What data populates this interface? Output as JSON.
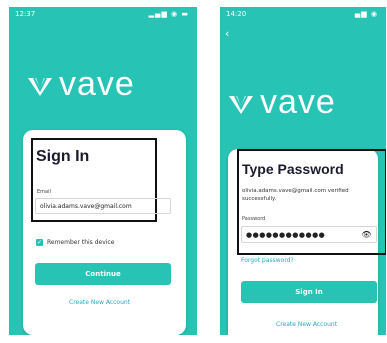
{
  "brand": {
    "name": "vave",
    "color": "#27c3b5"
  },
  "sign_in_screen": {
    "status_time": "12:37",
    "status_icons": "▂▄▆ ◉ ▬",
    "title": "Sign In",
    "email_label": "Email",
    "email_value": "olivia.adams.vave@gmail.com",
    "remember_label": "Remember this device",
    "remember_checked": true,
    "continue_label": "Continue",
    "create_account_label": "Create New Account"
  },
  "password_screen": {
    "status_time": "14:20",
    "status_icons": "▄▆ ◉",
    "back_icon": "chevron-left-icon",
    "title": "Type Password",
    "verified_message": "olivia.adams.vave@gmail.com verified successfully.",
    "password_label": "Password",
    "password_masked": "●●●●●●●●●●●●",
    "show_password_icon": "eye-icon",
    "forgot_label": "Forgot password?",
    "sign_in_label": "Sign In",
    "create_account_label": "Create New Account"
  }
}
